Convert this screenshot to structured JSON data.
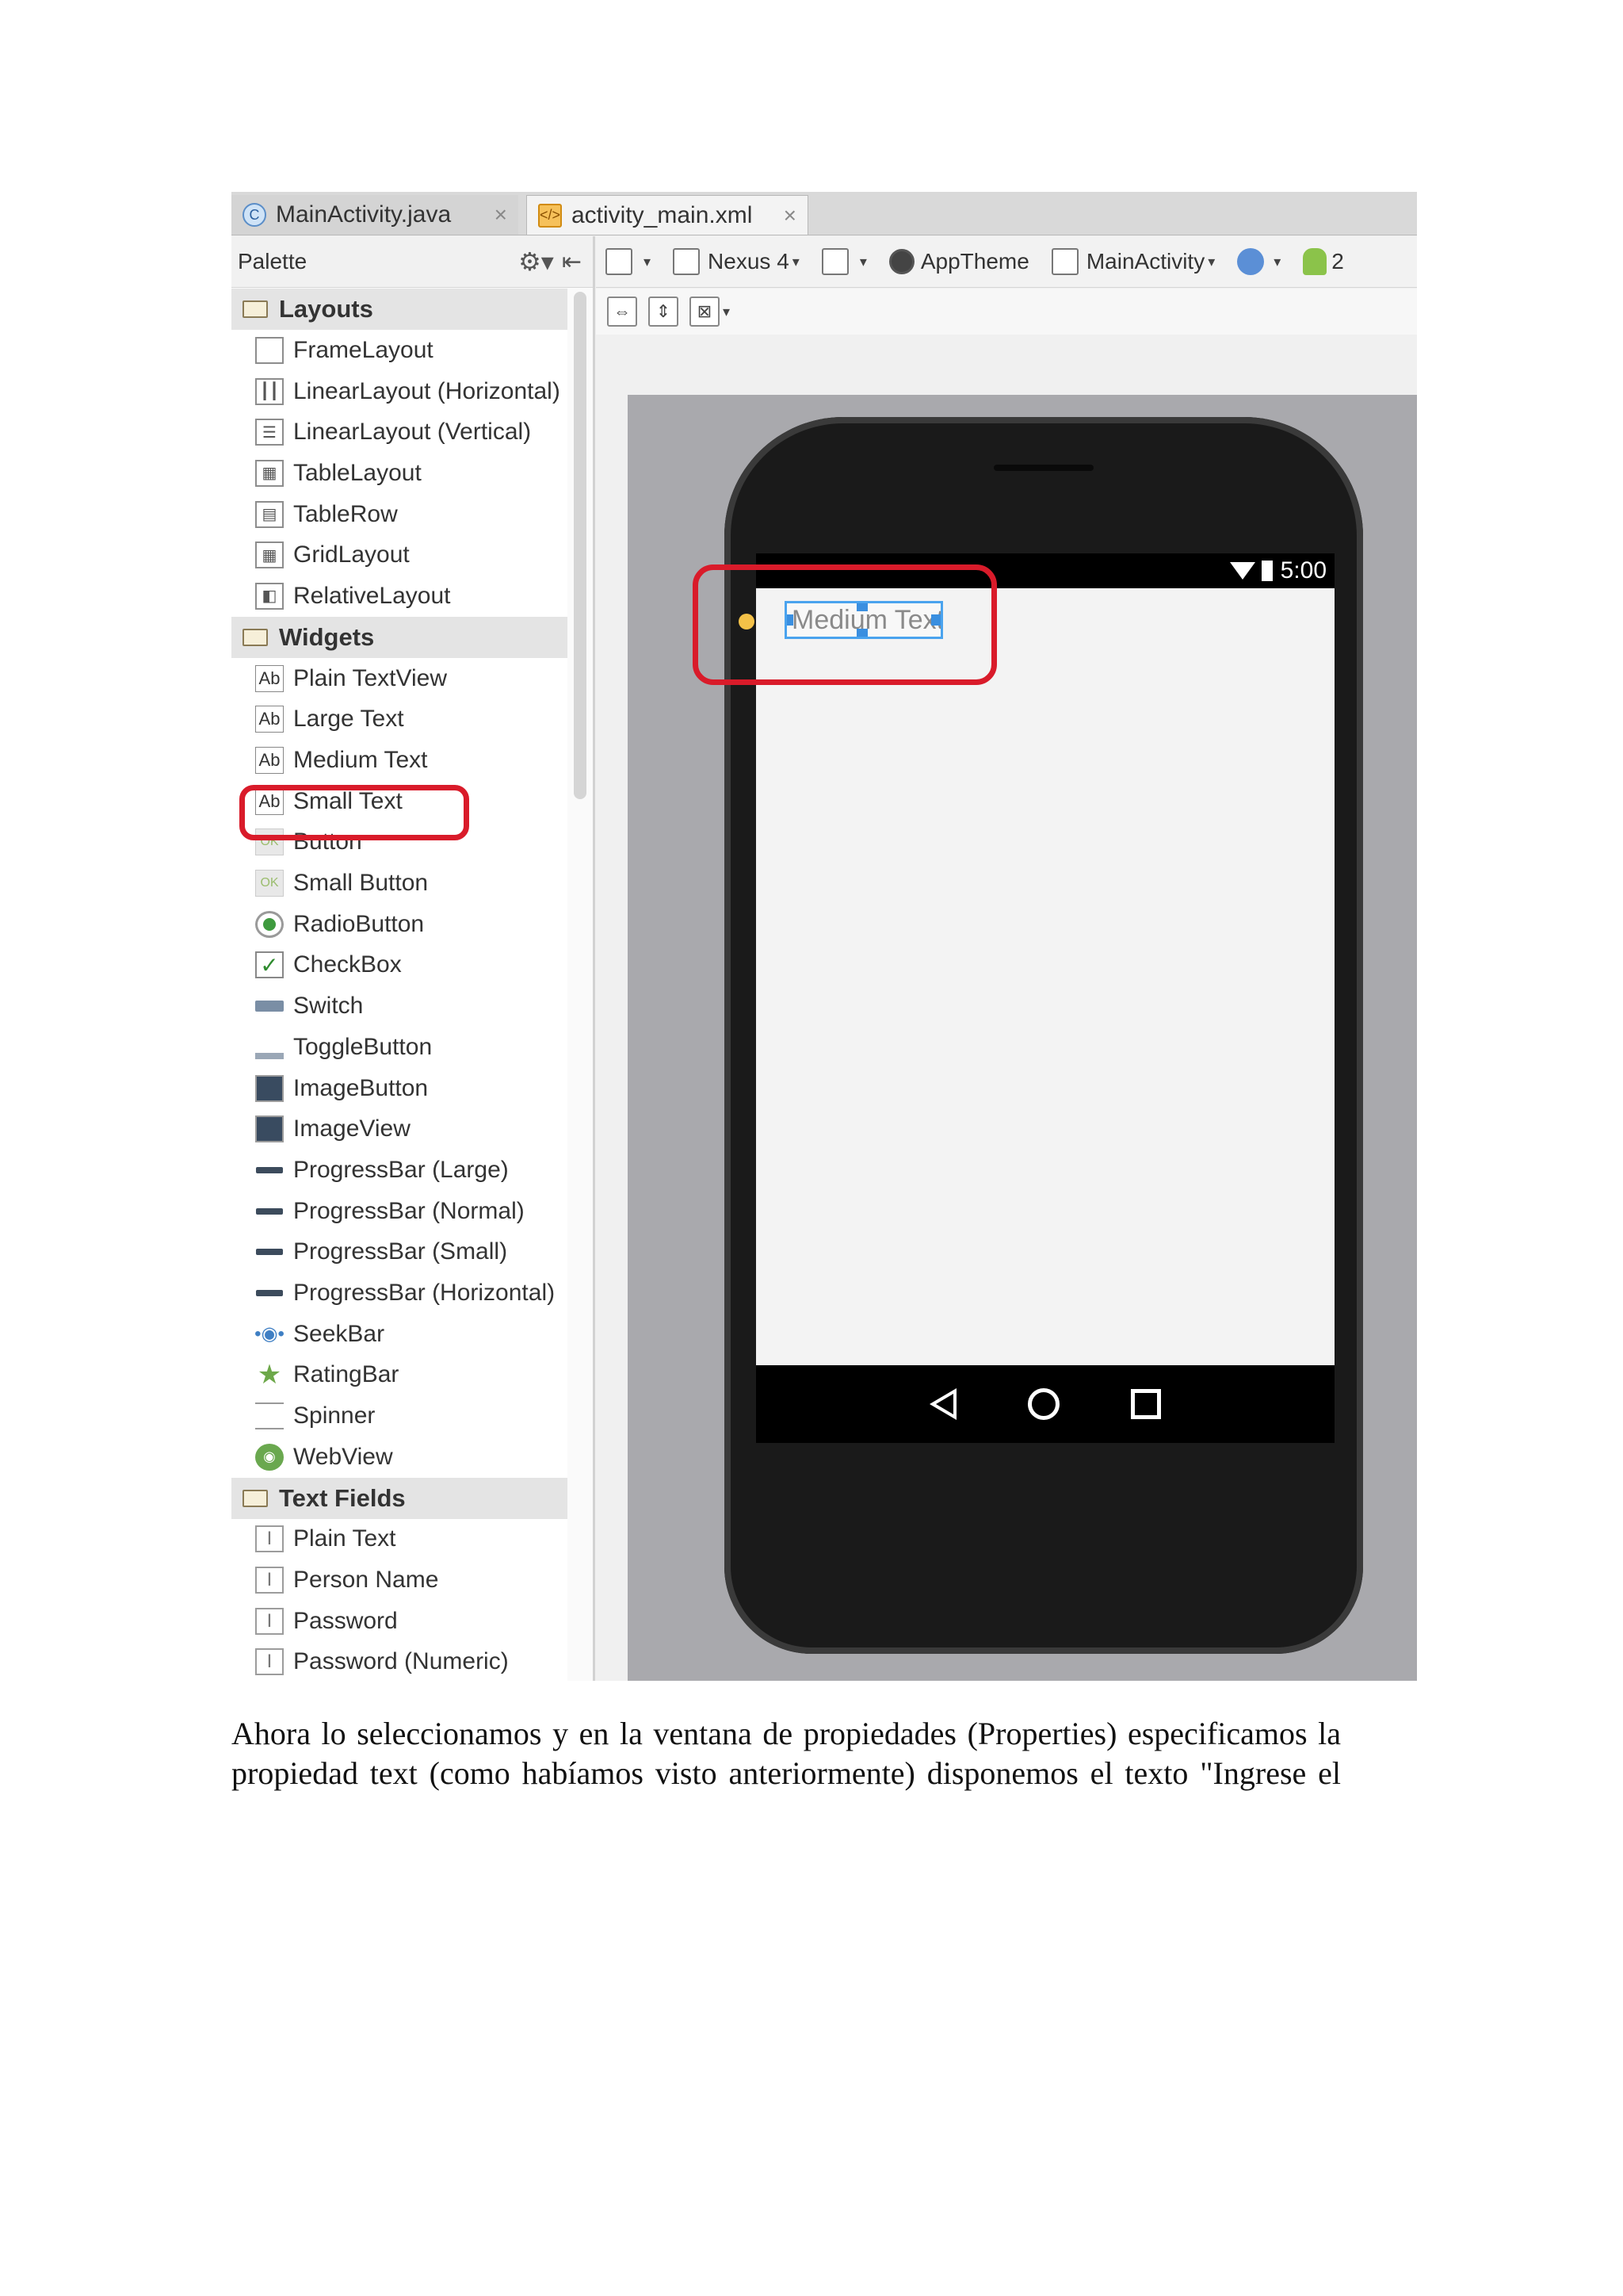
{
  "tabs": [
    {
      "label": "MainActivity.java",
      "icon": "C"
    },
    {
      "label": "activity_main.xml",
      "icon": "xml"
    }
  ],
  "palette": {
    "title": "Palette",
    "categories": [
      {
        "name": "Layouts",
        "items": [
          "FrameLayout",
          "LinearLayout (Horizontal)",
          "LinearLayout (Vertical)",
          "TableLayout",
          "TableRow",
          "GridLayout",
          "RelativeLayout"
        ]
      },
      {
        "name": "Widgets",
        "items": [
          "Plain TextView",
          "Large Text",
          "Medium Text",
          "Small Text",
          "Button",
          "Small Button",
          "RadioButton",
          "CheckBox",
          "Switch",
          "ToggleButton",
          "ImageButton",
          "ImageView",
          "ProgressBar (Large)",
          "ProgressBar (Normal)",
          "ProgressBar (Small)",
          "ProgressBar (Horizontal)",
          "SeekBar",
          "RatingBar",
          "Spinner",
          "WebView"
        ]
      },
      {
        "name": "Text Fields",
        "items": [
          "Plain Text",
          "Person Name",
          "Password",
          "Password (Numeric)"
        ]
      }
    ]
  },
  "toolbar": {
    "device": "Nexus 4",
    "theme": "AppTheme",
    "activity": "MainActivity",
    "api_partial": "2"
  },
  "device": {
    "status_time": "5:00",
    "widget_text": "Medium Text"
  },
  "caption": {
    "line1": "Ahora lo seleccionamos y en la ventana de propiedades (Properties) especificamos la",
    "line2": "propiedad text (como habíamos visto anteriormente) disponemos el texto \"Ingrese el"
  },
  "colors": {
    "highlight": "#d91b2a",
    "selection": "#4aa3ee"
  }
}
